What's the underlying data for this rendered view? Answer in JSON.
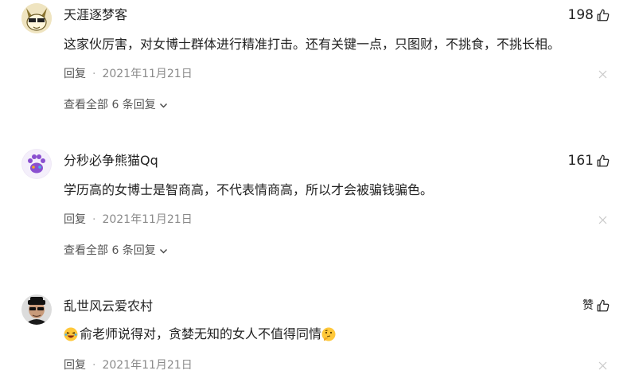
{
  "comments": [
    {
      "username": "天涯逐梦客",
      "likes": "198",
      "text": "这家伙厉害，对女博士群体进行精准打击。还有关键一点，只图财，不挑食，不挑长相。",
      "reply_label": "回复",
      "date": "2021年11月21日",
      "expand_label": "查看全部 6 条回复"
    },
    {
      "username": "分秒必争熊猫Qq",
      "likes": "161",
      "text": "学历高的女博士是智商高，不代表情商高，所以才会被骗钱骗色。",
      "reply_label": "回复",
      "date": "2021年11月21日",
      "expand_label": "查看全部 6 条回复"
    },
    {
      "username": "乱世风云爱农村",
      "likes": "赞",
      "text": "俞老师说得对，贪婪无知的女人不值得同情",
      "reply_label": "回复",
      "date": "2021年11月21日"
    }
  ],
  "icons": {
    "like": "thumbs-up-icon",
    "close": "close-icon",
    "expand": "chevron-down-icon",
    "emoji_laugh": "laughing-emoji",
    "emoji_think": "thinking-emoji"
  },
  "colors": {
    "text": "#222222",
    "meta": "#8a8a8a",
    "reply": "#555555"
  }
}
